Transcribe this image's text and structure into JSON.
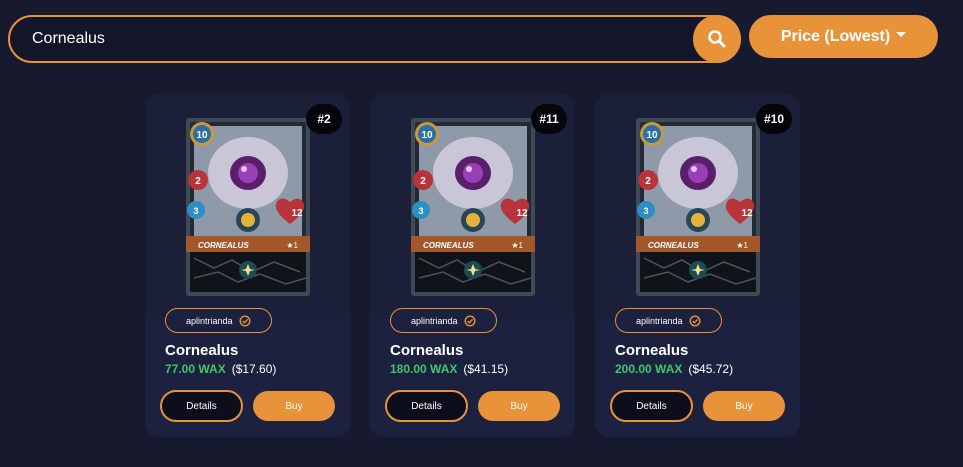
{
  "search": {
    "value": "Cornealus",
    "placeholder": ""
  },
  "sort": {
    "label": "Price (Lowest)"
  },
  "colors": {
    "accent": "#e8923a",
    "background": "#171a2e",
    "card": "#1d2140",
    "wax_price": "#3fc76a"
  },
  "cards": [
    {
      "rank": "#2",
      "seller": "aplintrianda",
      "name": "Cornealus",
      "price_wax": "77.00 WAX",
      "price_usd": "($17.60)",
      "details_label": "Details",
      "buy_label": "Buy",
      "art": {
        "mana": "10",
        "attack": "2",
        "speed": "3",
        "health": "12",
        "card_name": "CORNEALUS",
        "level": "★1"
      }
    },
    {
      "rank": "#11",
      "seller": "aplintrianda",
      "name": "Cornealus",
      "price_wax": "180.00 WAX",
      "price_usd": "($41.15)",
      "details_label": "Details",
      "buy_label": "Buy",
      "art": {
        "mana": "10",
        "attack": "2",
        "speed": "3",
        "health": "12",
        "card_name": "CORNEALUS",
        "level": "★1"
      }
    },
    {
      "rank": "#10",
      "seller": "aplintrianda",
      "name": "Cornealus",
      "price_wax": "200.00 WAX",
      "price_usd": "($45.72)",
      "details_label": "Details",
      "buy_label": "Buy",
      "art": {
        "mana": "10",
        "attack": "2",
        "speed": "3",
        "health": "12",
        "card_name": "CORNEALUS",
        "level": "★1"
      }
    }
  ]
}
